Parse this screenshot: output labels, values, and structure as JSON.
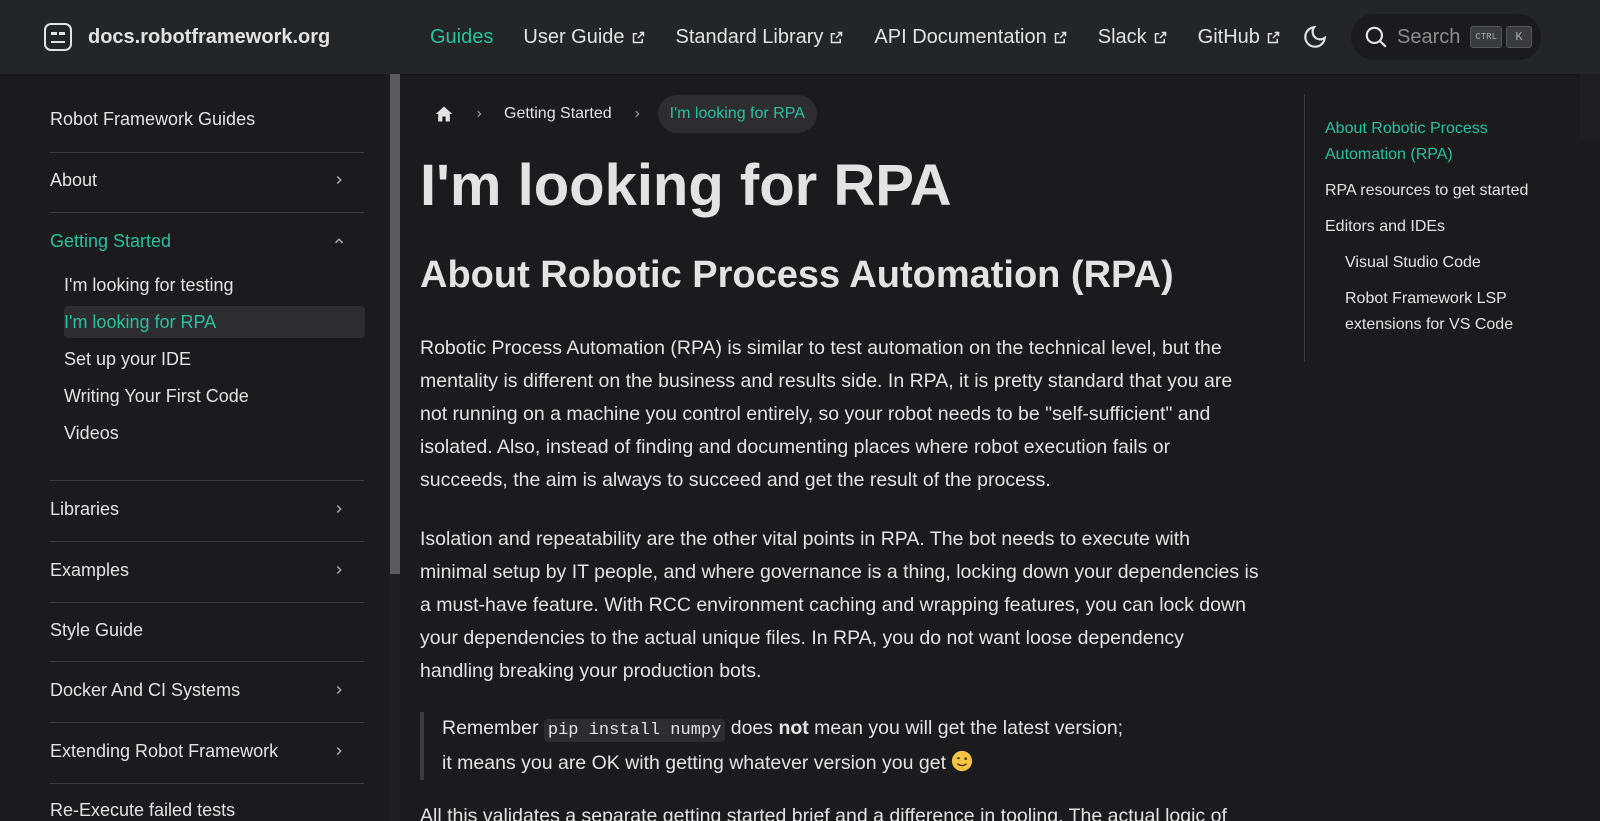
{
  "navbar": {
    "brand_title": "docs.robotframework.org",
    "links": [
      {
        "label": "Guides",
        "active": true,
        "external": false
      },
      {
        "label": "User Guide",
        "active": false,
        "external": true
      },
      {
        "label": "Standard Library",
        "active": false,
        "external": true
      },
      {
        "label": "API Documentation",
        "active": false,
        "external": true
      },
      {
        "label": "Slack",
        "active": false,
        "external": true
      },
      {
        "label": "GitHub",
        "active": false,
        "external": true
      }
    ],
    "search_label": "Search",
    "kbd_ctrl": "CTRL",
    "kbd_k": "K"
  },
  "sidebar": {
    "top": "Robot Framework Guides",
    "about": "About",
    "getting_started": "Getting Started",
    "sub": [
      "I'm looking for testing",
      "I'm looking for RPA",
      "Set up your IDE",
      "Writing Your First Code",
      "Videos"
    ],
    "libraries": "Libraries",
    "examples": "Examples",
    "style_guide": "Style Guide",
    "docker": "Docker And CI Systems",
    "extending": "Extending Robot Framework",
    "reexecute": "Re-Execute failed tests"
  },
  "breadcrumb": {
    "parent": "Getting Started",
    "current": "I'm looking for RPA"
  },
  "content": {
    "h1": "I'm looking for RPA",
    "h2": "About Robotic Process Automation (RPA)",
    "p1": "Robotic Process Automation (RPA) is similar to test automation on the technical level, but the mentality is different on the business and results side. In RPA, it is pretty standard that you are not running on a machine you control entirely, so your robot needs to be \"self-sufficient\" and isolated. Also, instead of finding and documenting places where robot execution fails or succeeds, the aim is always to succeed and get the result of the process.",
    "p2": "Isolation and repeatability are the other vital points in RPA. The bot needs to execute with minimal setup by IT people, and where governance is a thing, locking down your dependencies is a must-have feature. With RCC environment caching and wrapping features, you can lock down your dependencies to the actual unique files. In RPA, you do not want loose dependency handling breaking your production bots.",
    "quote_pre": "Remember ",
    "quote_code": "pip install numpy",
    "quote_mid": " does ",
    "quote_bold": "not",
    "quote_post": " mean you will get the latest version;",
    "quote_line2": "it means you are OK with getting whatever version you get",
    "p3": "All this validates a separate getting started brief and a difference in tooling. The actual logic of"
  },
  "toc": {
    "items": [
      "About Robotic Process Automation (RPA)",
      "RPA resources to get started",
      "Editors and IDEs",
      "Visual Studio Code",
      "Robot Framework LSP extensions for VS Code"
    ]
  },
  "colors": {
    "accent": "#25c2a0",
    "background": "#1b1b1d",
    "navbar": "#242526"
  }
}
